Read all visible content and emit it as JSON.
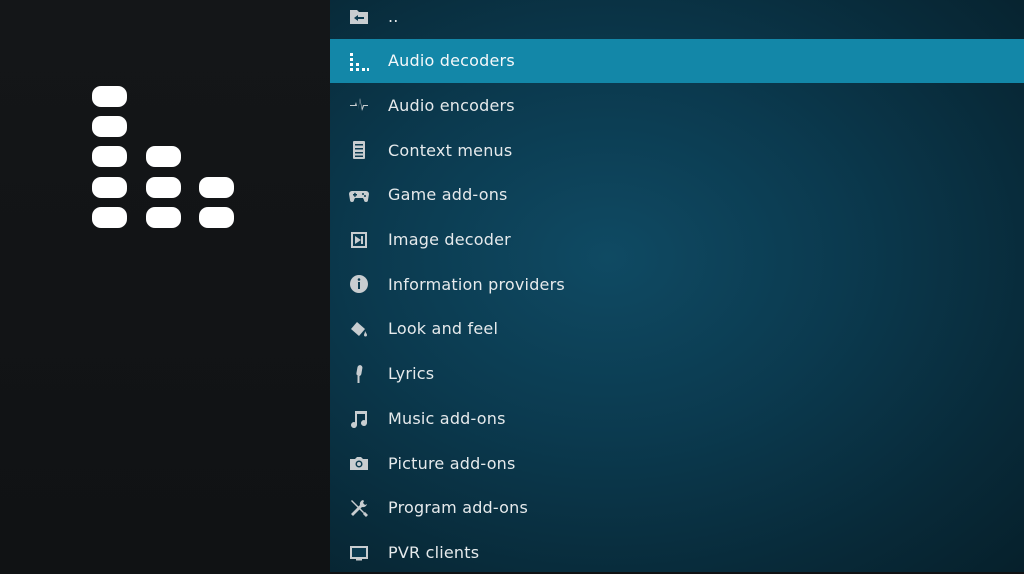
{
  "category_icon": "audio-decoder-bars-icon",
  "accent": "#1387a8",
  "list": {
    "selected_index": 1,
    "items": [
      {
        "label": "..",
        "icon": "folder-back-icon"
      },
      {
        "label": "Audio decoders",
        "icon": "equalizer-icon"
      },
      {
        "label": "Audio encoders",
        "icon": "waveform-icon"
      },
      {
        "label": "Context menus",
        "icon": "menu-list-icon"
      },
      {
        "label": "Game add-ons",
        "icon": "gamepad-icon"
      },
      {
        "label": "Image decoder",
        "icon": "image-icon"
      },
      {
        "label": "Information providers",
        "icon": "info-icon"
      },
      {
        "label": "Look and feel",
        "icon": "paint-bucket-icon"
      },
      {
        "label": "Lyrics",
        "icon": "microphone-icon"
      },
      {
        "label": "Music add-ons",
        "icon": "music-note-icon"
      },
      {
        "label": "Picture add-ons",
        "icon": "camera-icon"
      },
      {
        "label": "Program add-ons",
        "icon": "tools-icon"
      },
      {
        "label": "PVR clients",
        "icon": "tv-icon"
      }
    ]
  }
}
